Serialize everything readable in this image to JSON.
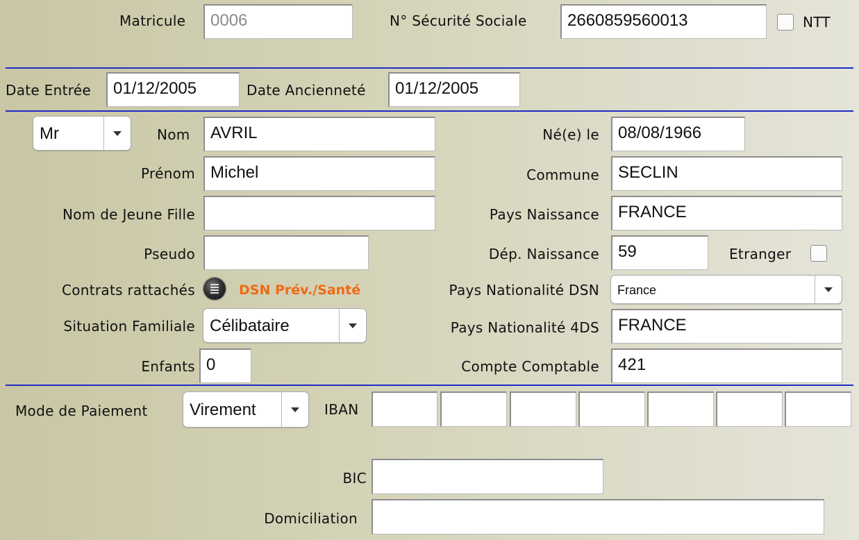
{
  "header": {
    "matricule": {
      "label": "Matricule",
      "value": "0006"
    },
    "secu": {
      "label": "N° Sécurité Sociale",
      "value": "2660859560013"
    },
    "ntt": {
      "label": "NTT",
      "checked": false
    }
  },
  "dates": {
    "entree": {
      "label": "Date Entrée",
      "value": "01/12/2005"
    },
    "anciennete": {
      "label": "Date Ancienneté",
      "value": "01/12/2005"
    }
  },
  "identity": {
    "civilite": "Mr",
    "nom": {
      "label": "Nom",
      "value": "AVRIL"
    },
    "prenom": {
      "label": "Prénom",
      "value": "Michel"
    },
    "jeune_fille": {
      "label": "Nom de Jeune Fille",
      "value": ""
    },
    "pseudo": {
      "label": "Pseudo",
      "value": ""
    },
    "contrats": {
      "label": "Contrats rattachés",
      "link": "DSN Prév./Santé"
    },
    "situation": {
      "label": "Situation Familiale",
      "value": "Célibataire"
    },
    "enfants": {
      "label": "Enfants",
      "value": "0"
    },
    "naissance": {
      "label": "Né(e) le",
      "value": "08/08/1966"
    },
    "commune": {
      "label": "Commune",
      "value": "SECLIN"
    },
    "pays_naissance": {
      "label": "Pays Naissance",
      "value": "FRANCE"
    },
    "dep_naissance": {
      "label": "Dép. Naissance",
      "value": "59"
    },
    "etranger": {
      "label": "Etranger",
      "checked": false
    },
    "nat_dsn": {
      "label": "Pays Nationalité DSN",
      "value": "France"
    },
    "nat_4ds": {
      "label": "Pays Nationalité 4DS",
      "value": "FRANCE"
    },
    "compte": {
      "label": "Compte Comptable",
      "value": "421"
    }
  },
  "payment": {
    "mode": {
      "label": "Mode de Paiement",
      "value": "Virement"
    },
    "iban": {
      "label": "IBAN",
      "parts": [
        "",
        "",
        "",
        "",
        "",
        "",
        ""
      ]
    },
    "bic": {
      "label": "BIC",
      "value": ""
    },
    "domiciliation": {
      "label": "Domiciliation",
      "value": ""
    }
  },
  "colors": {
    "separator": "#1f2cc4",
    "link": "#ef6a12"
  }
}
